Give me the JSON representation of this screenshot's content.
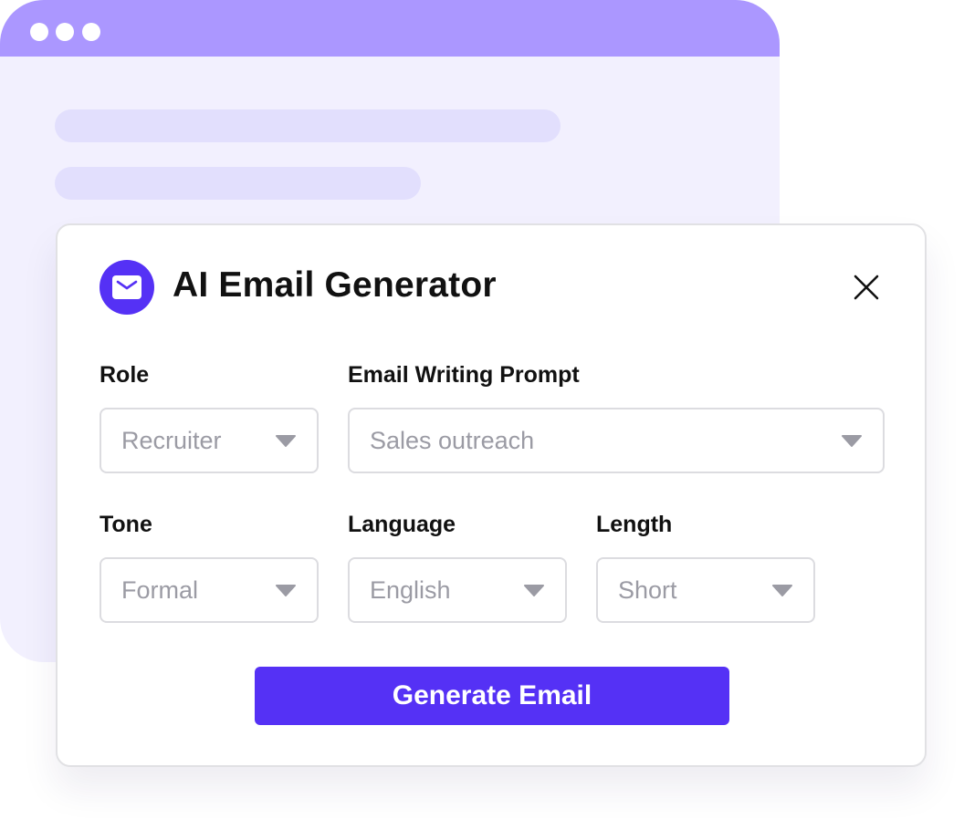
{
  "background_window": {
    "titlebar_dots": 3,
    "colors": {
      "titlebar": "#ab97ff",
      "body": "#f2f0fe",
      "skeleton": "#e2dffd"
    }
  },
  "modal": {
    "title": "AI Email Generator",
    "icons": {
      "header": "mail-icon",
      "close": "close-icon",
      "dropdown": "caret-down-icon"
    },
    "fields": {
      "role": {
        "label": "Role",
        "value": "Recruiter"
      },
      "prompt": {
        "label": "Email Writing Prompt",
        "value": "Sales outreach"
      },
      "tone": {
        "label": "Tone",
        "value": "Formal"
      },
      "language": {
        "label": "Language",
        "value": "English"
      },
      "length": {
        "label": "Length",
        "value": "Short"
      }
    },
    "generate_button": "Generate Email",
    "colors": {
      "accent": "#5531f5",
      "placeholder_text": "#9b9ba4",
      "border": "#dcdce0"
    }
  }
}
